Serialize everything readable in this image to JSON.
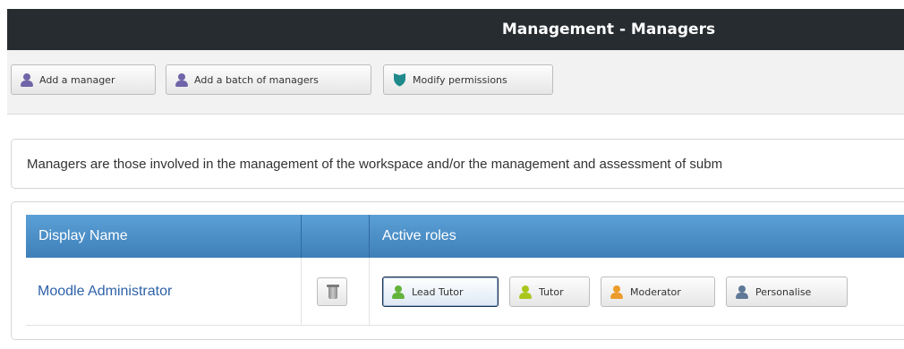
{
  "header": {
    "title": "Management - Managers"
  },
  "toolbar": {
    "buttons": [
      {
        "label": "Add a manager",
        "icon": "person-icon"
      },
      {
        "label": "Add a batch of managers",
        "icon": "person-icon"
      },
      {
        "label": "Modify permissions",
        "icon": "shield-icon"
      }
    ]
  },
  "info": {
    "text": "Managers are those involved in the management of the workspace and/or the management and assessment of subm"
  },
  "table": {
    "columns": [
      "Display Name",
      "",
      "Active roles"
    ],
    "rows": [
      {
        "display_name": "Moodle Administrator",
        "delete_icon": "trash-icon",
        "roles": [
          {
            "label": "Lead Tutor",
            "active": true,
            "color": "#64b33b"
          },
          {
            "label": "Tutor",
            "active": false,
            "color": "#a9c71b"
          },
          {
            "label": "Moderator",
            "active": false,
            "color": "#eb9c2a"
          },
          {
            "label": "Personalise",
            "active": false,
            "color": "#5f7897"
          }
        ]
      }
    ]
  },
  "colors": {
    "title_bar": "#272c30",
    "table_header": "#4a8cc7",
    "link": "#2e62a8",
    "shield": "#1f8a8c"
  }
}
